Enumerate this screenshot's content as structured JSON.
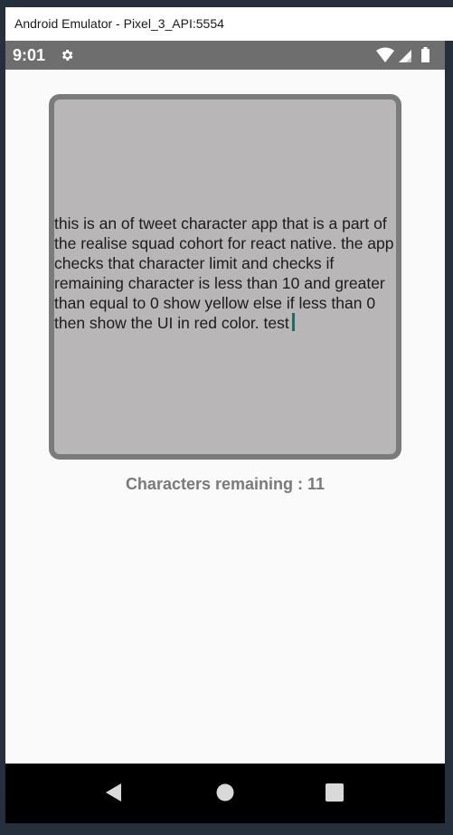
{
  "window": {
    "title": "Android Emulator - Pixel_3_API:5554"
  },
  "status_bar": {
    "time": "9:01",
    "icons": [
      "gear-icon",
      "wifi-icon",
      "signal-icon",
      "battery-icon"
    ]
  },
  "tweet": {
    "text": "this is an of tweet character app that is a part of the realise squad cohort for react native. the app checks that character limit and checks if remaining character is less than 10 and greater than equal to 0 show yellow else if less than 0 then show the UI in red color. test"
  },
  "counter": {
    "label": "Characters remaining : 11"
  },
  "nav_bar": {
    "icons": [
      "back-icon",
      "home-icon",
      "recents-icon"
    ]
  },
  "colors": {
    "box_fill": "#b8b6b7",
    "box_border": "#7b7b7b",
    "counter_text": "#7a7a7a",
    "cursor": "#00796b"
  }
}
